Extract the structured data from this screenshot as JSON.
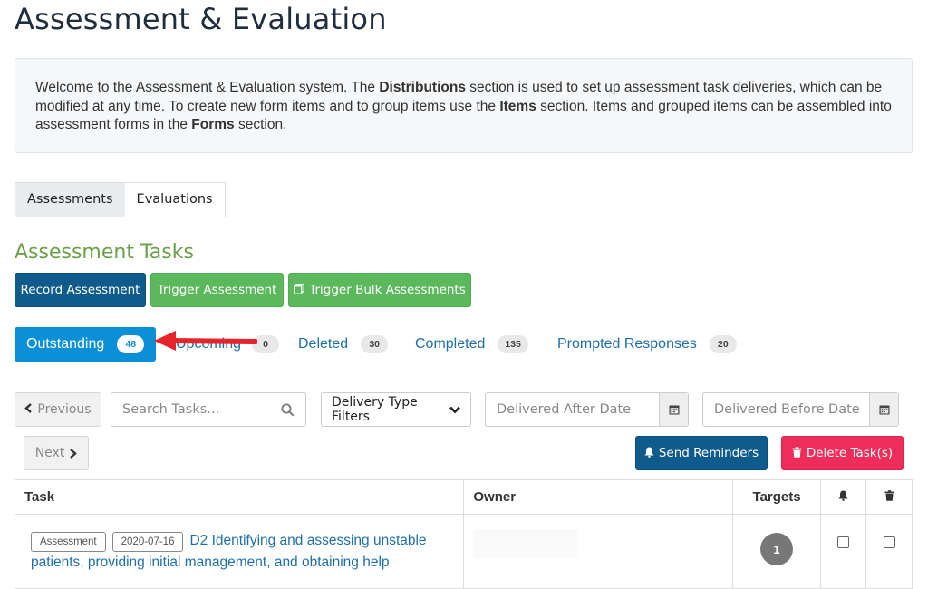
{
  "page": {
    "title": "Assessment & Evaluation"
  },
  "info": {
    "p1": "Welcome to the Assessment & Evaluation system. The ",
    "b1": "Distributions",
    "p2": " section is used to set up assessment task deliveries, which can be modified at any time. To create new form items and to group items use the ",
    "b2": "Items",
    "p3": " section. Items and grouped items can be assembled into assessment forms in the ",
    "b3": "Forms",
    "p4": " section."
  },
  "type_tabs": [
    {
      "label": "Assessments",
      "active": true
    },
    {
      "label": "Evaluations",
      "active": false
    }
  ],
  "section": {
    "title": "Assessment Tasks"
  },
  "actions": {
    "record": "Record Assessment",
    "trigger": "Trigger Assessment",
    "trigger_bulk": "Trigger Bulk Assessments"
  },
  "status_tabs": [
    {
      "label": "Outstanding",
      "count": "48",
      "active": true
    },
    {
      "label": "Upcoming",
      "count": "0",
      "active": false
    },
    {
      "label": "Deleted",
      "count": "30",
      "active": false
    },
    {
      "label": "Completed",
      "count": "135",
      "active": false
    },
    {
      "label": "Prompted Responses",
      "count": "20",
      "active": false
    }
  ],
  "filters": {
    "previous": "Previous",
    "next": "Next",
    "search_placeholder": "Search Tasks...",
    "delivery_type": "Delivery Type Filters",
    "after_placeholder": "Delivered After Date",
    "before_placeholder": "Delivered Before Date",
    "send_reminders": "Send Reminders",
    "delete_tasks": "Delete Task(s)"
  },
  "table": {
    "headers": {
      "task": "Task",
      "owner": "Owner",
      "targets": "Targets"
    },
    "rows": [
      {
        "type": "Assessment",
        "date": "2020-07-16",
        "title": "D2 Identifying and assessing unstable patients, providing initial management, and obtaining help",
        "owner": "",
        "targets": "1"
      }
    ]
  },
  "colors": {
    "primary_blue": "#0e5b8c",
    "active_tab": "#0b8fd6",
    "success_green": "#5cb85c",
    "danger_red": "#ef2d5a",
    "section_green": "#6ba04a",
    "annotation_arrow": "#e5252b"
  },
  "icons": {
    "bell": "bell-icon",
    "trash": "trash-icon",
    "calendar": "calendar-icon",
    "search": "search-icon",
    "copy": "copy-icon"
  }
}
